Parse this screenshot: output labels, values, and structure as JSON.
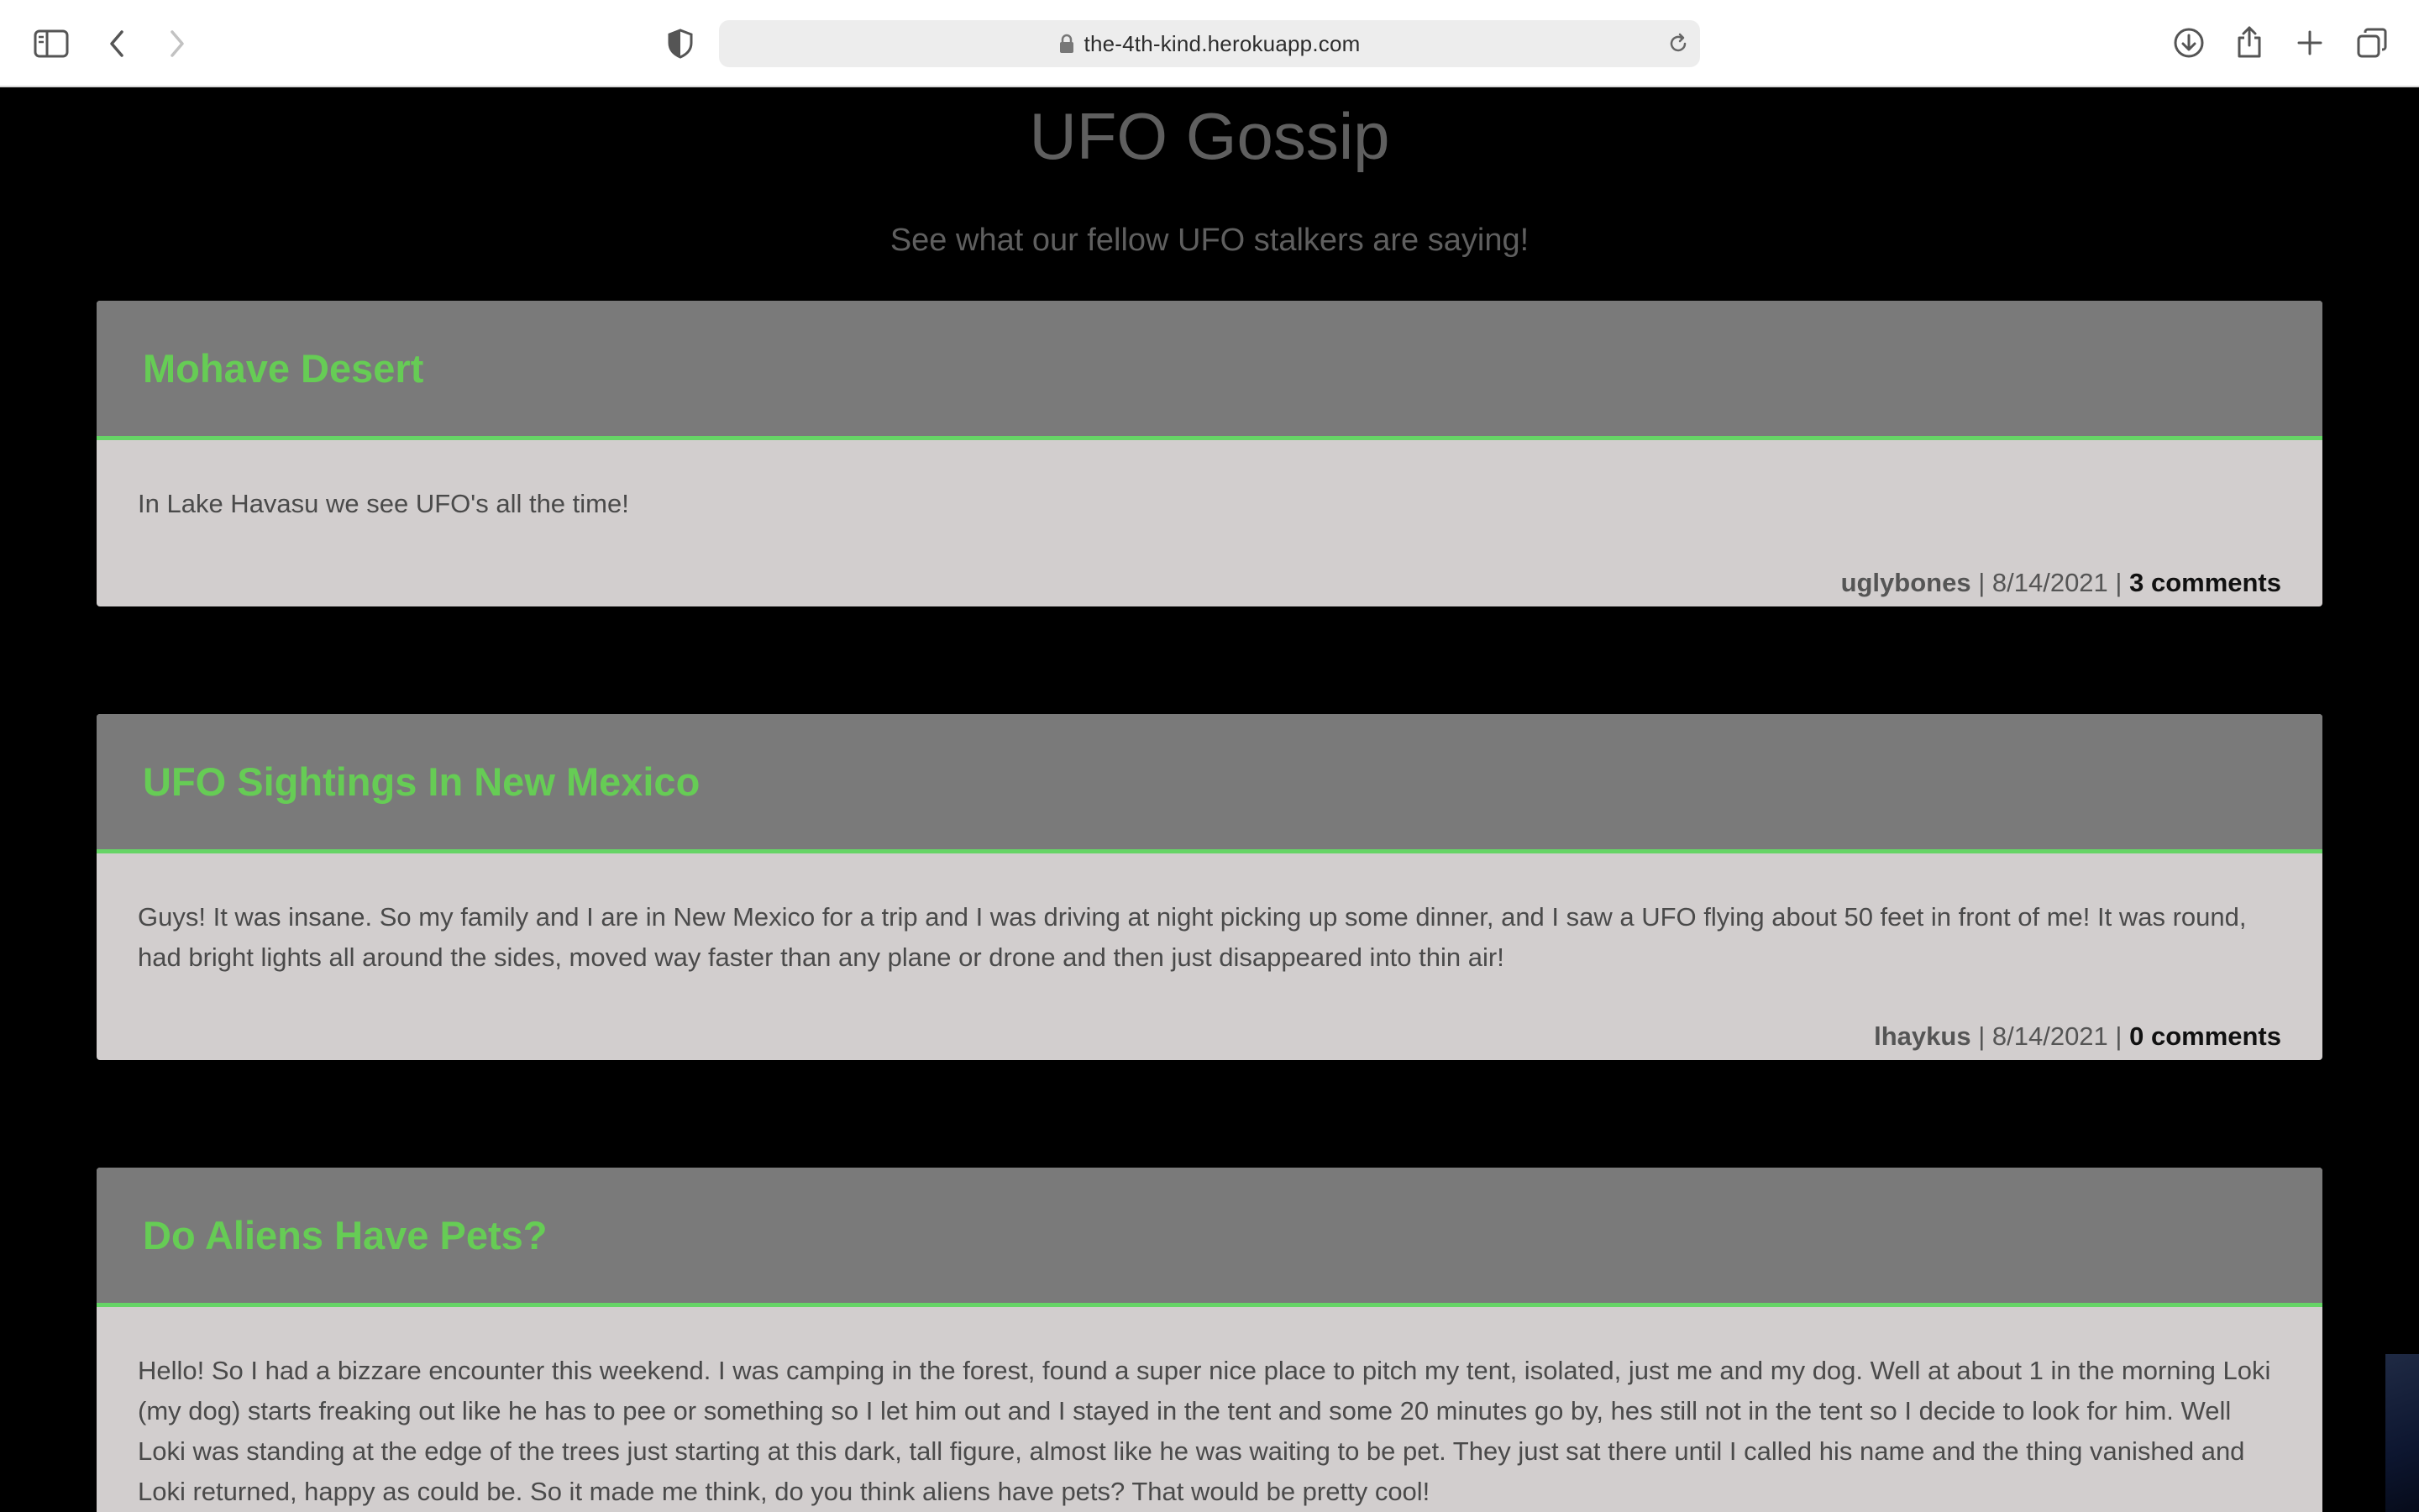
{
  "browser": {
    "url": "the-4th-kind.herokuapp.com",
    "icons": [
      "sidebar-icon",
      "back-icon",
      "forward-icon",
      "shield-icon",
      "lock-icon",
      "reload-icon",
      "download-icon",
      "share-icon",
      "new-tab-icon",
      "tab-overview-icon"
    ]
  },
  "page": {
    "title": "UFO Gossip",
    "subtitle": "See what our fellow UFO stalkers are saying!"
  },
  "posts": [
    {
      "title": "Mohave Desert",
      "body": "In Lake Havasu we see UFO's all the time!",
      "author": "uglybones",
      "date": "8/14/2021",
      "comments": "3 comments"
    },
    {
      "title": "UFO Sightings In New Mexico",
      "body": "Guys! It was insane. So my family and I are in New Mexico for a trip and I was driving at night picking up some dinner, and I saw a UFO flying about 50 feet in front of me! It was round, had bright lights all around the sides, moved way faster than any plane or drone and then just disappeared into thin air!",
      "author": "lhaykus",
      "date": "8/14/2021",
      "comments": "0 comments"
    },
    {
      "title": "Do Aliens Have Pets?",
      "body": "Hello! So I had a bizzare encounter this weekend. I was camping in the forest, found a super nice place to pitch my tent, isolated, just me and my dog. Well at about 1 in the morning Loki (my dog) starts freaking out like he has to pee or something so I let him out and I stayed in the tent and some 20 minutes go by, hes still not in the tent so I decide to look for him. Well Loki was standing at the edge of the trees just starting at this dark, tall figure, almost like he was waiting to be pet. They just sat there until I called his name and the thing vanished and Loki returned, happy as could be. So it made me think, do you think aliens have pets? That would be pretty cool!"
    }
  ],
  "colors": {
    "page_bg": "#000000",
    "card_header": "#7a7a7a",
    "card_body": "#d2cece",
    "title_green": "#66cc55",
    "accent_border": "#66d466"
  }
}
